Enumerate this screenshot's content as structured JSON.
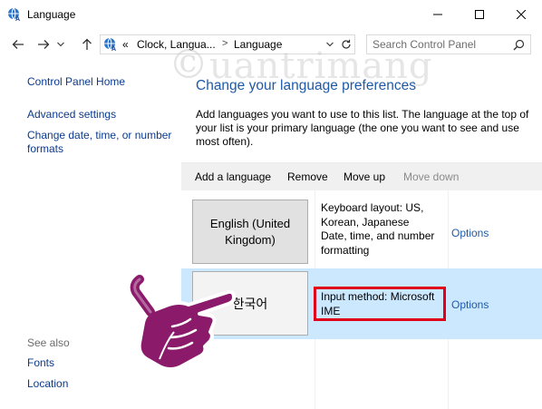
{
  "window": {
    "title": "Language"
  },
  "address_bar": {
    "overflow": "«",
    "crumbs": [
      "Clock, Langua...",
      "Language"
    ],
    "separator": ">"
  },
  "search": {
    "placeholder": "Search Control Panel"
  },
  "left_pane": {
    "home": "Control Panel Home",
    "advanced": "Advanced settings",
    "change_date": "Change date, time, or number formats",
    "see_also": "See also",
    "fonts": "Fonts",
    "location": "Location"
  },
  "main": {
    "heading": "Change your language preferences",
    "description": "Add languages you want to use to this list. The language at the top of your list is your primary language (the one you want to see and use most often).",
    "toolbar": {
      "add": "Add a language",
      "remove": "Remove",
      "move_up": "Move up",
      "move_down": "Move down"
    },
    "languages": [
      {
        "name": "English (United Kingdom)",
        "info": "Keyboard layout: US, Korean, Japanese\nDate, time, and number formatting",
        "options": "Options"
      },
      {
        "name": "한국어",
        "info": "Input method: Microsoft IME",
        "options": "Options"
      }
    ]
  },
  "watermark": "uantrimang",
  "colors": {
    "link": "#0b3a8c",
    "heading": "#1e5aa8",
    "selected_row": "#cce8ff",
    "highlight_box": "#e0001a",
    "hand": "#8b1a6b"
  }
}
